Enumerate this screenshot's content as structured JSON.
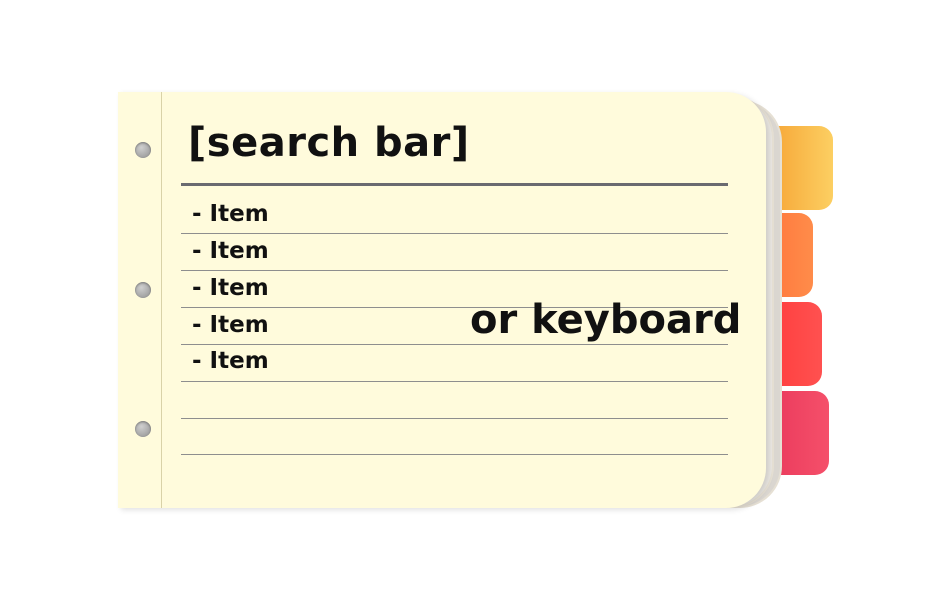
{
  "notebook": {
    "title": "[search bar]",
    "items": [
      "- Item",
      "- Item",
      "- Item",
      "- Item",
      "- Item"
    ],
    "side_text": "or keyboard"
  },
  "colors": {
    "paper": "#fffbdc",
    "tab_1": "#f7b043",
    "tab_2": "#ff7a3c",
    "tab_3": "#ff4343",
    "tab_4": "#ee4563"
  }
}
